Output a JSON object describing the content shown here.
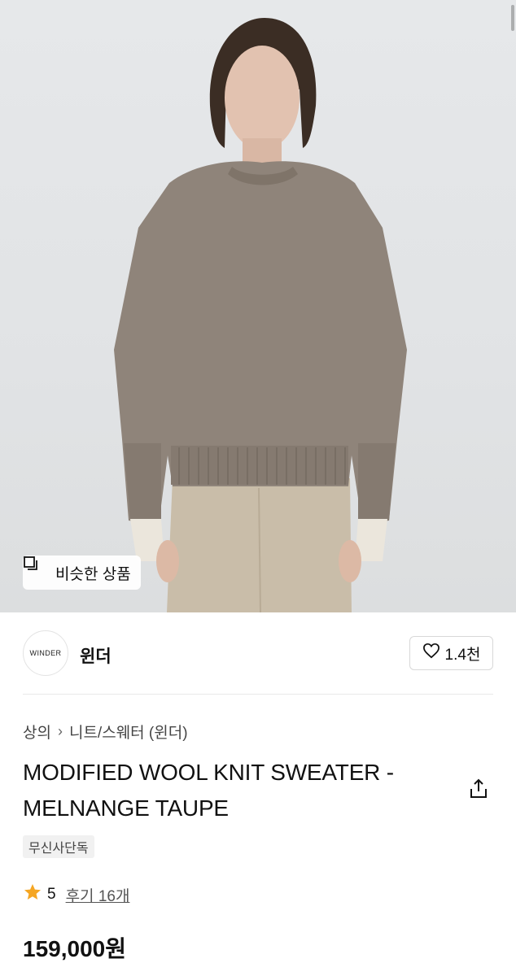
{
  "hero": {
    "similar_button_label": "비슷한 상품"
  },
  "brand": {
    "logo_text": "WINDER",
    "name": "윈더",
    "like_count": "1.4천"
  },
  "breadcrumb": {
    "category": "상의",
    "subcategory": "니트/스웨터 (윈더)"
  },
  "product": {
    "title": "MODIFIED WOOL KNIT SWEATER - MELNANGE TAUPE",
    "tag": "무신사단독",
    "rating": "5",
    "reviews_label": "후기 16개",
    "price": "159,000원"
  },
  "colors": {
    "star": "#f5a623",
    "sweater": "#8f847a",
    "pants": "#c9bda9"
  },
  "icons": {
    "similar": "similar-items-icon",
    "heart": "heart-icon",
    "share": "share-icon",
    "star": "star-icon"
  }
}
